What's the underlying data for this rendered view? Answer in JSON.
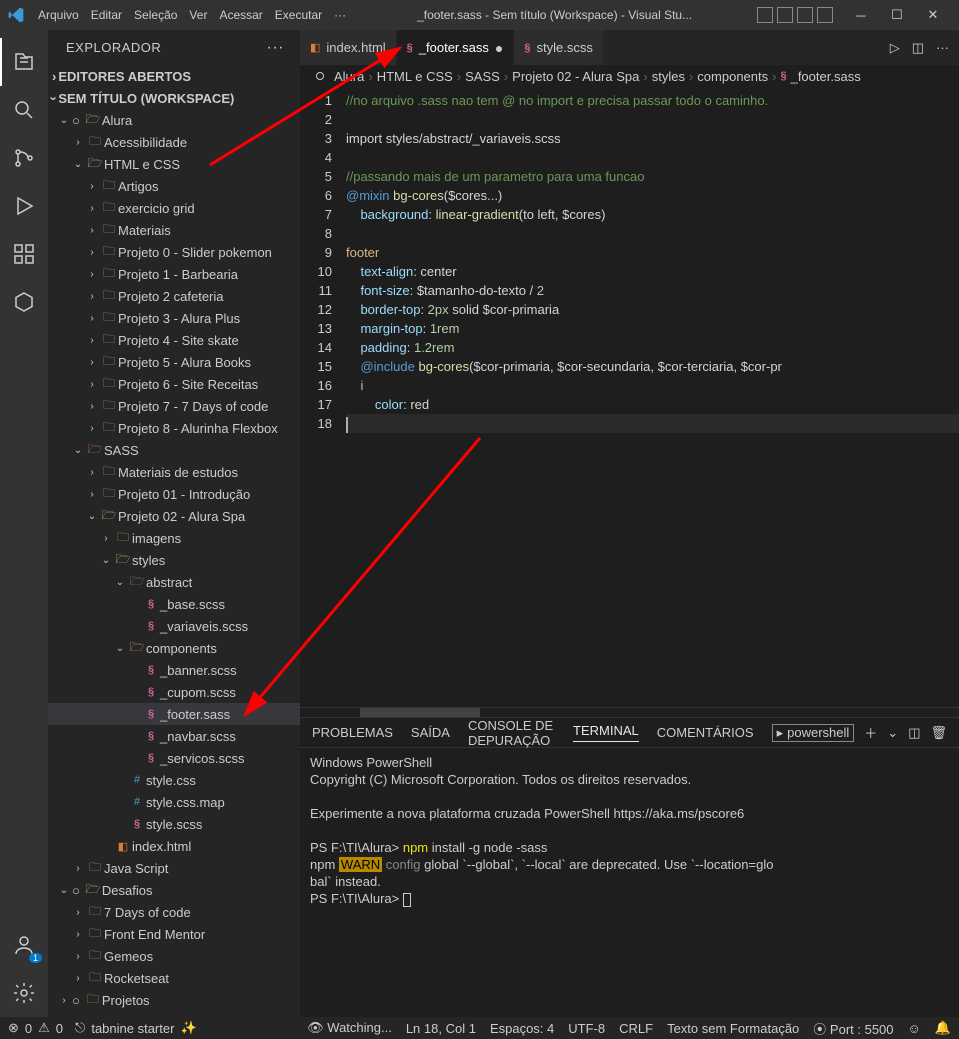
{
  "titlebar": {
    "menus": [
      "Arquivo",
      "Editar",
      "Seleção",
      "Ver",
      "Acessar",
      "Executar",
      "···"
    ],
    "title": "_footer.sass - Sem título (Workspace) - Visual Stu..."
  },
  "activity_icons": [
    "files",
    "search",
    "source-control",
    "debug",
    "extensions",
    "hex",
    "accounts",
    "settings"
  ],
  "sidebar": {
    "title": "EXPLORADOR",
    "sections": {
      "editors": "EDITORES ABERTOS",
      "workspace": "SEM TÍTULO (WORKSPACE)"
    },
    "tree": [
      {
        "d": 0,
        "t": "folder-open",
        "exp": true,
        "outline": true,
        "label": "Alura"
      },
      {
        "d": 1,
        "t": "folder",
        "exp": false,
        "label": "Acessibilidade"
      },
      {
        "d": 1,
        "t": "folder-open",
        "exp": true,
        "label": "HTML e CSS"
      },
      {
        "d": 2,
        "t": "folder",
        "exp": false,
        "label": "Artigos"
      },
      {
        "d": 2,
        "t": "folder",
        "exp": false,
        "label": "exercicio grid"
      },
      {
        "d": 2,
        "t": "folder",
        "exp": false,
        "label": "Materiais"
      },
      {
        "d": 2,
        "t": "folder",
        "exp": false,
        "label": "Projeto 0 - Slider pokemon"
      },
      {
        "d": 2,
        "t": "folder",
        "exp": false,
        "label": "Projeto 1 - Barbearia"
      },
      {
        "d": 2,
        "t": "folder",
        "exp": false,
        "label": "Projeto 2 cafeteria"
      },
      {
        "d": 2,
        "t": "folder",
        "exp": false,
        "label": "Projeto 3 - Alura Plus"
      },
      {
        "d": 2,
        "t": "folder",
        "exp": false,
        "label": "Projeto 4 - Site skate"
      },
      {
        "d": 2,
        "t": "folder",
        "exp": false,
        "label": "Projeto 5 - Alura Books"
      },
      {
        "d": 2,
        "t": "folder",
        "exp": false,
        "label": "Projeto 6 - Site Receitas"
      },
      {
        "d": 2,
        "t": "folder",
        "exp": false,
        "label": "Projeto 7 - 7 Days of code"
      },
      {
        "d": 2,
        "t": "folder",
        "exp": false,
        "label": "Projeto 8 - Alurinha Flexbox"
      },
      {
        "d": 1,
        "t": "folder-open",
        "exp": true,
        "color": "#cf649a",
        "label": "SASS"
      },
      {
        "d": 2,
        "t": "folder",
        "exp": false,
        "label": "Materiais de estudos"
      },
      {
        "d": 2,
        "t": "folder",
        "exp": false,
        "label": "Projeto 01 - Introdução"
      },
      {
        "d": 2,
        "t": "folder-open",
        "exp": true,
        "label": "Projeto 02 - Alura Spa"
      },
      {
        "d": 3,
        "t": "folder",
        "exp": false,
        "label": "imagens"
      },
      {
        "d": 3,
        "t": "folder-open",
        "exp": true,
        "label": "styles"
      },
      {
        "d": 4,
        "t": "folder-open",
        "exp": true,
        "color": "#8e7b5e",
        "label": "abstract"
      },
      {
        "d": 5,
        "t": "sass",
        "label": "_base.scss"
      },
      {
        "d": 5,
        "t": "sass",
        "label": "_variaveis.scss"
      },
      {
        "d": 4,
        "t": "folder-open",
        "exp": true,
        "color": "#c0a46b",
        "label": "components"
      },
      {
        "d": 5,
        "t": "sass",
        "label": "_banner.scss"
      },
      {
        "d": 5,
        "t": "sass",
        "label": "_cupom.scss"
      },
      {
        "d": 5,
        "t": "sass",
        "label": "_footer.sass",
        "selected": true
      },
      {
        "d": 5,
        "t": "sass",
        "label": "_navbar.scss"
      },
      {
        "d": 5,
        "t": "sass",
        "label": "_servicos.scss"
      },
      {
        "d": 4,
        "t": "css",
        "label": "style.css"
      },
      {
        "d": 4,
        "t": "css",
        "label": "style.css.map"
      },
      {
        "d": 4,
        "t": "sass",
        "label": "style.scss"
      },
      {
        "d": 3,
        "t": "html",
        "label": "index.html"
      },
      {
        "d": 1,
        "t": "folder",
        "exp": false,
        "label": "Java Script"
      },
      {
        "d": 0,
        "t": "folder-open",
        "exp": true,
        "outline": true,
        "label": "Desafios"
      },
      {
        "d": 1,
        "t": "folder",
        "exp": false,
        "label": "7 Days of code"
      },
      {
        "d": 1,
        "t": "folder",
        "exp": false,
        "label": "Front End Mentor"
      },
      {
        "d": 1,
        "t": "folder",
        "exp": false,
        "label": "Gemeos"
      },
      {
        "d": 1,
        "t": "folder",
        "exp": false,
        "label": "Rocketseat"
      },
      {
        "d": 0,
        "t": "folder",
        "exp": false,
        "outline": true,
        "label": "Projetos"
      }
    ]
  },
  "tabs": [
    {
      "icon": "html",
      "label": "index.html",
      "active": false,
      "modified": false
    },
    {
      "icon": "sass",
      "label": "_footer.sass",
      "active": true,
      "modified": true
    },
    {
      "icon": "sass",
      "label": "style.scss",
      "active": false,
      "modified": false
    }
  ],
  "breadcrumb": [
    "Alura",
    "HTML e CSS",
    "SASS",
    "Projeto 02 - Alura Spa",
    "styles",
    "components",
    "_footer.sass"
  ],
  "code_lines": [
    {
      "n": 1,
      "html": "<span class='c-comment'>//no arquivo .sass nao tem @ no import e precisa passar todo o caminho.</span>"
    },
    {
      "n": 2,
      "html": ""
    },
    {
      "n": 3,
      "html": "<span class='c-text'>import styles/abstract/_variaveis.scss</span>"
    },
    {
      "n": 4,
      "html": ""
    },
    {
      "n": 5,
      "html": "<span class='c-comment'>//passando mais de um parametro para uma funcao</span>"
    },
    {
      "n": 6,
      "html": "<span class='c-key'>@mixin</span> <span class='c-func'>bg-cores</span><span class='c-text'>($cores...)</span>"
    },
    {
      "n": 7,
      "html": "    <span class='c-prop'>background</span><span class='c-text'>: </span><span class='c-func'>linear-gradient</span><span class='c-text'>(to left, $cores)</span>"
    },
    {
      "n": 8,
      "html": ""
    },
    {
      "n": 9,
      "html": "<span class='c-tag'>footer</span>"
    },
    {
      "n": 10,
      "html": "    <span class='c-prop'>text-align</span><span class='c-text'>: center</span>"
    },
    {
      "n": 11,
      "html": "    <span class='c-prop'>font-size</span><span class='c-text'>: $tamanho-do-texto / </span><span class='c-num'>2</span>"
    },
    {
      "n": 12,
      "html": "    <span class='c-prop'>border-top</span><span class='c-text'>: </span><span class='c-num'>2px</span><span class='c-text'> solid $cor-primaria</span>"
    },
    {
      "n": 13,
      "html": "    <span class='c-prop'>margin-top</span><span class='c-text'>: </span><span class='c-num'>1rem</span>"
    },
    {
      "n": 14,
      "html": "    <span class='c-prop'>padding</span><span class='c-text'>: </span><span class='c-num'>1.2rem</span>"
    },
    {
      "n": 15,
      "html": "    <span class='c-key'>@include</span> <span class='c-func'>bg-cores</span><span class='c-text'>($cor-primaria, $cor-secundaria, $cor-terciaria, $cor-pr</span>"
    },
    {
      "n": 16,
      "html": "    <span class='c-tag'>i</span>"
    },
    {
      "n": 17,
      "html": "        <span class='c-prop'>color</span><span class='c-text'>: red</span>"
    },
    {
      "n": 18,
      "html": "<span class='cursor-line'></span>",
      "hl": true
    }
  ],
  "panel": {
    "tabs": [
      "PROBLEMAS",
      "SAÍDA",
      "CONSOLE DE DEPURAÇÃO",
      "TERMINAL",
      "COMENTÁRIOS"
    ],
    "active_tab": 3,
    "shell_label": "powershell",
    "lines": [
      "Windows PowerShell",
      "Copyright (C) Microsoft Corporation. Todos os direitos reservados.",
      "",
      "Experimente a nova plataforma cruzada PowerShell https://aka.ms/pscore6",
      "",
      "PS F:\\TI\\Alura> <cmd>npm</cmd> install -g node -sass",
      "npm <warn>WARN</warn> <g>config</g> global `--global`, `--local` are deprecated. Use `--location=glo",
      "bal` instead.",
      "PS F:\\TI\\Alura> <cur/>"
    ]
  },
  "status": {
    "left": {
      "errors": "0",
      "warnings": "0",
      "tabnine": "tabnine starter"
    },
    "watching": "Watching...",
    "ln_col": "Ln 18, Col 1",
    "spaces": "Espaços: 4",
    "encoding": "UTF-8",
    "eol": "CRLF",
    "lang": "Texto sem Formatação",
    "port": "Port : 5500"
  }
}
